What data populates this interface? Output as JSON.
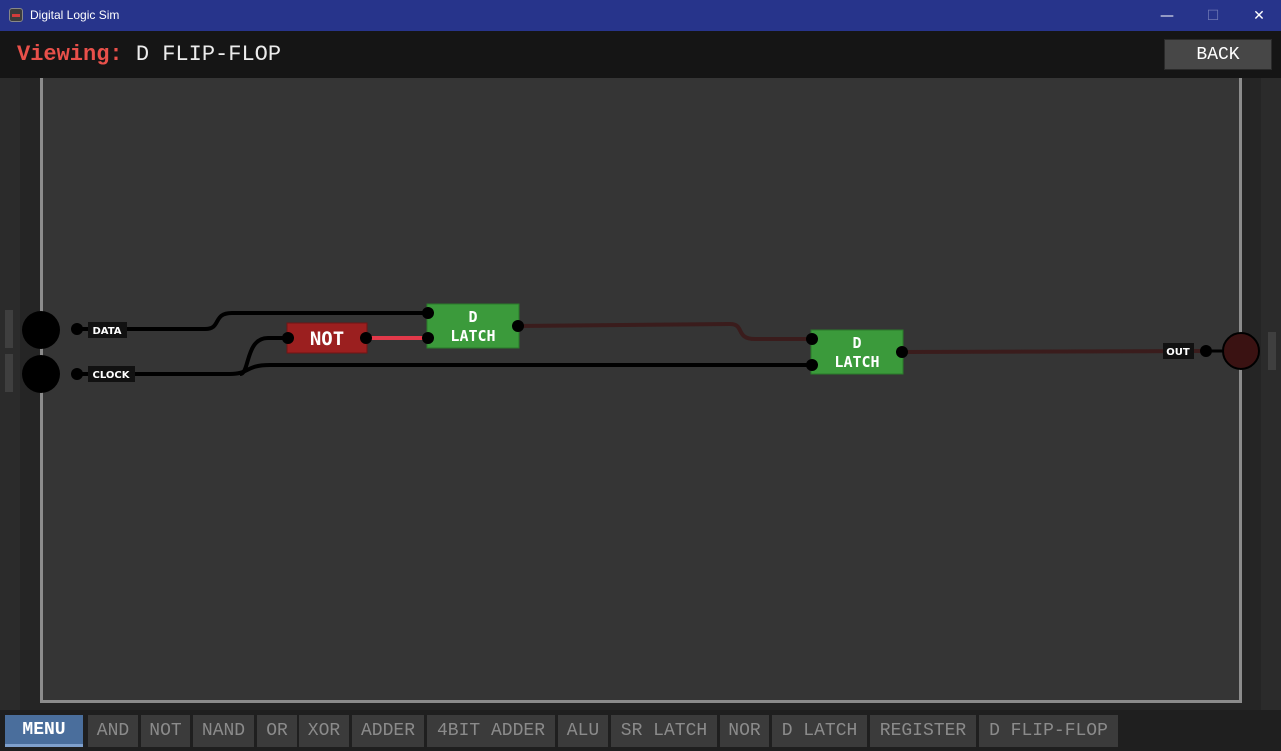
{
  "window": {
    "title": "Digital Logic Sim",
    "minimize_glyph": "—",
    "maximize_glyph": "☐",
    "close_glyph": "✕"
  },
  "header": {
    "viewing_label": "Viewing:",
    "chip_name": "D FLIP-FLOP",
    "back_label": "BACK"
  },
  "circuit": {
    "inputs": [
      {
        "label": "DATA"
      },
      {
        "label": "CLOCK"
      }
    ],
    "outputs": [
      {
        "label": "OUT"
      }
    ],
    "chips": [
      {
        "name": "NOT",
        "color": "#9b1f1f"
      },
      {
        "line1": "D",
        "line2": "LATCH",
        "color": "#3b9a3b"
      },
      {
        "line1": "D",
        "line2": "LATCH",
        "color": "#3b9a3b"
      }
    ],
    "colors": {
      "wire_off": "#000000",
      "wire_on": "#e2394a",
      "wire_dim": "#3a1c1c",
      "output_off": "#3a1212"
    }
  },
  "bottombar": {
    "menu_label": "MENU",
    "chips": [
      "AND",
      "NOT",
      "NAND",
      "OR",
      "XOR",
      "ADDER",
      "4BIT ADDER",
      "ALU",
      "SR LATCH",
      "NOR",
      "D LATCH",
      "REGISTER",
      "D FLIP-FLOP"
    ]
  }
}
